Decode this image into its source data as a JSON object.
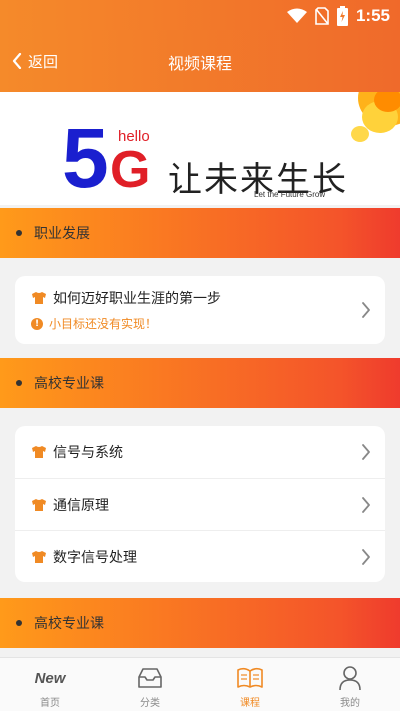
{
  "status": {
    "time": "1:55"
  },
  "header": {
    "back_label": "返回",
    "title": "视频课程"
  },
  "banner": {
    "big_digit": "5",
    "letter": "G",
    "hello": "hello",
    "slogan": "让未来生长",
    "slogan_en": "Let the Future Grow"
  },
  "sections": [
    {
      "title": "职业发展",
      "items": [
        {
          "title": "如何迈好职业生涯的第一步",
          "notice": "小目标还没有实现！"
        }
      ]
    },
    {
      "title": "高校专业课",
      "items": [
        {
          "title": "信号与系统"
        },
        {
          "title": "通信原理"
        },
        {
          "title": "数字信号处理"
        }
      ]
    },
    {
      "title": "高校专业课"
    }
  ],
  "tabs": [
    {
      "label": "首页",
      "icon": "new-badge-icon",
      "logo_text": "New"
    },
    {
      "label": "分类",
      "icon": "inbox-icon"
    },
    {
      "label": "课程",
      "icon": "book-icon",
      "active": true
    },
    {
      "label": "我的",
      "icon": "person-icon"
    }
  ],
  "colors": {
    "accent": "#f08a24",
    "header_start": "#f58a2a",
    "header_end": "#ef6a2b",
    "section_end": "#ef3b2d",
    "banner_blue": "#1a1fcf",
    "banner_red": "#e01f27"
  }
}
